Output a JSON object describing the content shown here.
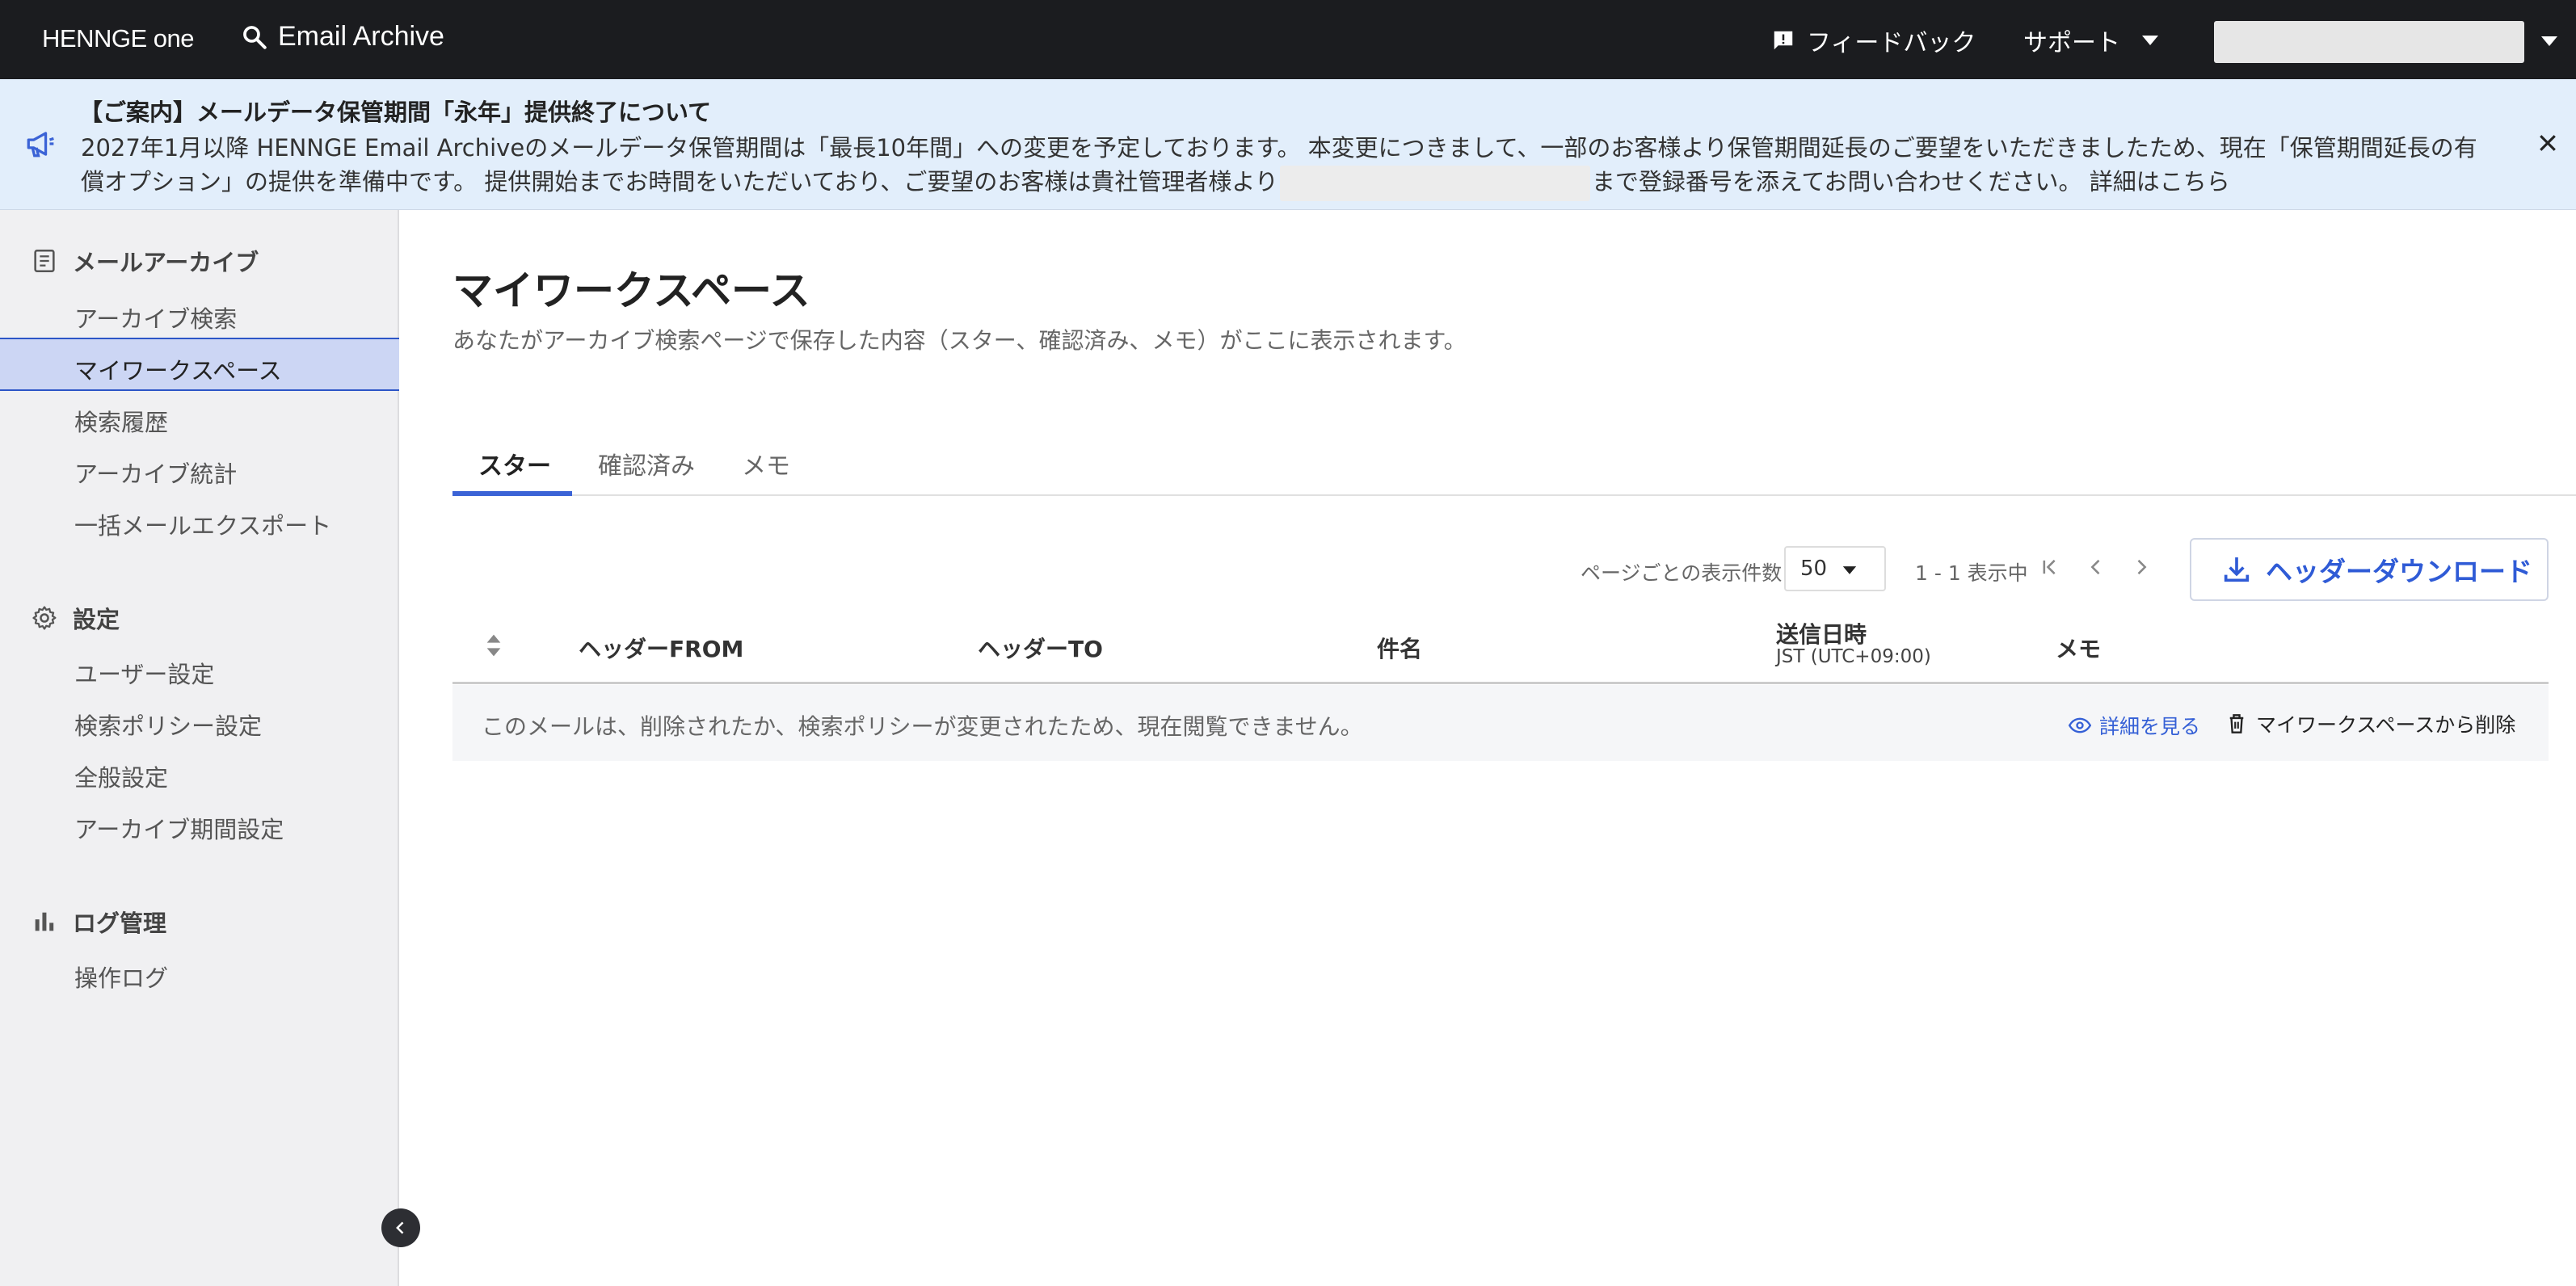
{
  "header": {
    "logo_prefix": "HENNGE",
    "logo_suffix": "one",
    "app_title": "Email Archive",
    "feedback_label": "フィードバック",
    "support_label": "サポート"
  },
  "notice": {
    "title": "【ご案内】メールデータ保管期間「永年」提供終了について",
    "body_before": "2027年1月以降 HENNGE Email Archiveのメールデータ保管期間は「最長10年間」への変更を予定しております。 本変更につきまして、一部のお客様より保管期間延長のご要望をいただきましたため、現在「保管期間延長の有償オプション」の提供を準備中です。 提供開始までお時間をいただいており、ご要望のお客様は貴社管理者様より",
    "body_after": "まで登録番号を添えてお問い合わせください。 詳細はこちら"
  },
  "sidebar": {
    "sections": [
      {
        "label": "メールアーカイブ",
        "icon": "archive-icon"
      },
      {
        "label": "設定",
        "icon": "gear-icon"
      },
      {
        "label": "ログ管理",
        "icon": "bar-chart-icon"
      }
    ],
    "archive_items": [
      "アーカイブ検索",
      "マイワークスペース",
      "検索履歴",
      "アーカイブ統計",
      "一括メールエクスポート"
    ],
    "settings_items": [
      "ユーザー設定",
      "検索ポリシー設定",
      "全般設定",
      "アーカイブ期間設定"
    ],
    "log_items": [
      "操作ログ"
    ],
    "active_item": "マイワークスペース"
  },
  "main": {
    "title": "マイワークスペース",
    "description": "あなたがアーカイブ検索ページで保存した内容（スター、確認済み、メモ）がここに表示されます。",
    "tabs": [
      "スター",
      "確認済み",
      "メモ"
    ],
    "active_tab": "スター",
    "per_page_label": "ページごとの表示件数",
    "per_page_value": "50",
    "range_text": "1 - 1 表示中",
    "download_label": "ヘッダーダウンロード",
    "table": {
      "columns": [
        "ヘッダーFROM",
        "ヘッダーTO",
        "件名",
        "送信日時",
        "メモ"
      ],
      "date_sub": "JST (UTC+09:00)",
      "rows": [
        {
          "message": "このメールは、削除されたか、検索ポリシーが変更されたため、現在閲覧できません。",
          "view_label": "詳細を見る",
          "delete_label": "マイワークスペースから削除"
        }
      ]
    }
  },
  "colors": {
    "topbar": "#1b1c1f",
    "notice_bg": "#e2eefb",
    "accent": "#3b63d6",
    "sidebar_bg": "#f0f0f2",
    "sidebar_active": "#ccd6f4"
  }
}
